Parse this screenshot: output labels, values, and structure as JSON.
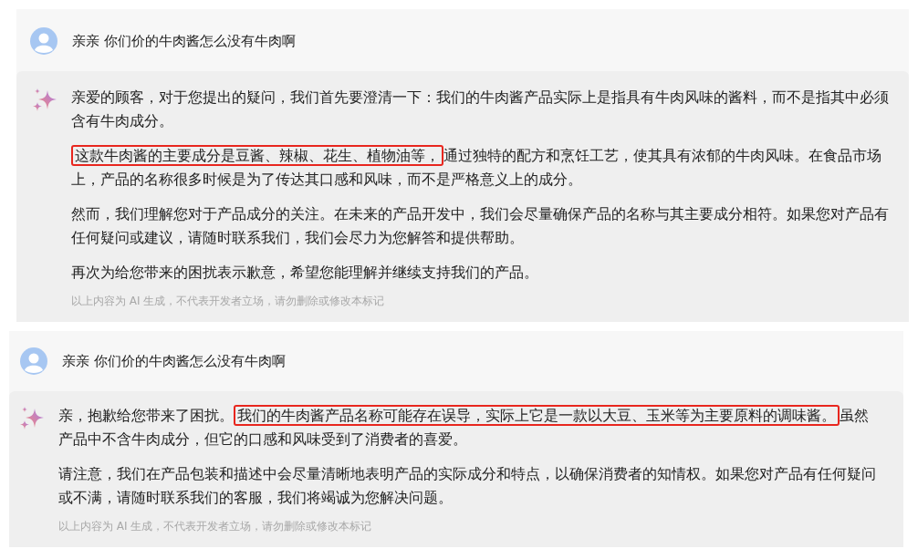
{
  "conversations": [
    {
      "question": "亲亲 你们价的牛肉酱怎么没有牛肉啊",
      "paragraphs": [
        {
          "segments": [
            {
              "text": "亲爱的顾客，对于您提出的疑问，我们首先要澄清一下：我们的牛肉酱产品实际上是指具有牛肉风味的酱料，而不是指其中必须含有牛肉成分。",
              "highlighted": false
            }
          ]
        },
        {
          "segments": [
            {
              "text": "这款牛肉酱的主要成分是豆酱、辣椒、花生、植物油等，",
              "highlighted": true
            },
            {
              "text": "通过独特的配方和烹饪工艺，使其具有浓郁的牛肉风味。在食品市场上，产品的名称很多时候是为了传达其口感和风味，而不是严格意义上的成分。",
              "highlighted": false
            }
          ]
        },
        {
          "segments": [
            {
              "text": "然而，我们理解您对于产品成分的关注。在未来的产品开发中，我们会尽量确保产品的名称与其主要成分相符。如果您对产品有任何疑问或建议，请随时联系我们，我们会尽力为您解答和提供帮助。",
              "highlighted": false
            }
          ]
        },
        {
          "segments": [
            {
              "text": "再次为给您带来的困扰表示歉意，希望您能理解并继续支持我们的产品。",
              "highlighted": false
            }
          ]
        }
      ],
      "disclaimer": "以上内容为 AI 生成，不代表开发者立场，请勿删除或修改本标记"
    },
    {
      "question": "亲亲 你们价的牛肉酱怎么没有牛肉啊",
      "paragraphs": [
        {
          "segments": [
            {
              "text": "亲，抱歉给您带来了困扰。",
              "highlighted": false
            },
            {
              "text": "我们的牛肉酱产品名称可能存在误导，实际上它是一款以大豆、玉米等为主要原料的调味酱。",
              "highlighted": true
            },
            {
              "text": "虽然产品中不含牛肉成分，但它的口感和风味受到了消费者的喜爱。",
              "highlighted": false
            }
          ]
        },
        {
          "segments": [
            {
              "text": "请注意，我们在产品包装和描述中会尽量清晰地表明产品的实际成分和特点，以确保消费者的知情权。如果您对产品有任何疑问或不满，请随时联系我们的客服，我们将竭诚为您解决问题。",
              "highlighted": false
            }
          ]
        }
      ],
      "disclaimer": "以上内容为 AI 生成，不代表开发者立场，请勿删除或修改本标记"
    }
  ]
}
